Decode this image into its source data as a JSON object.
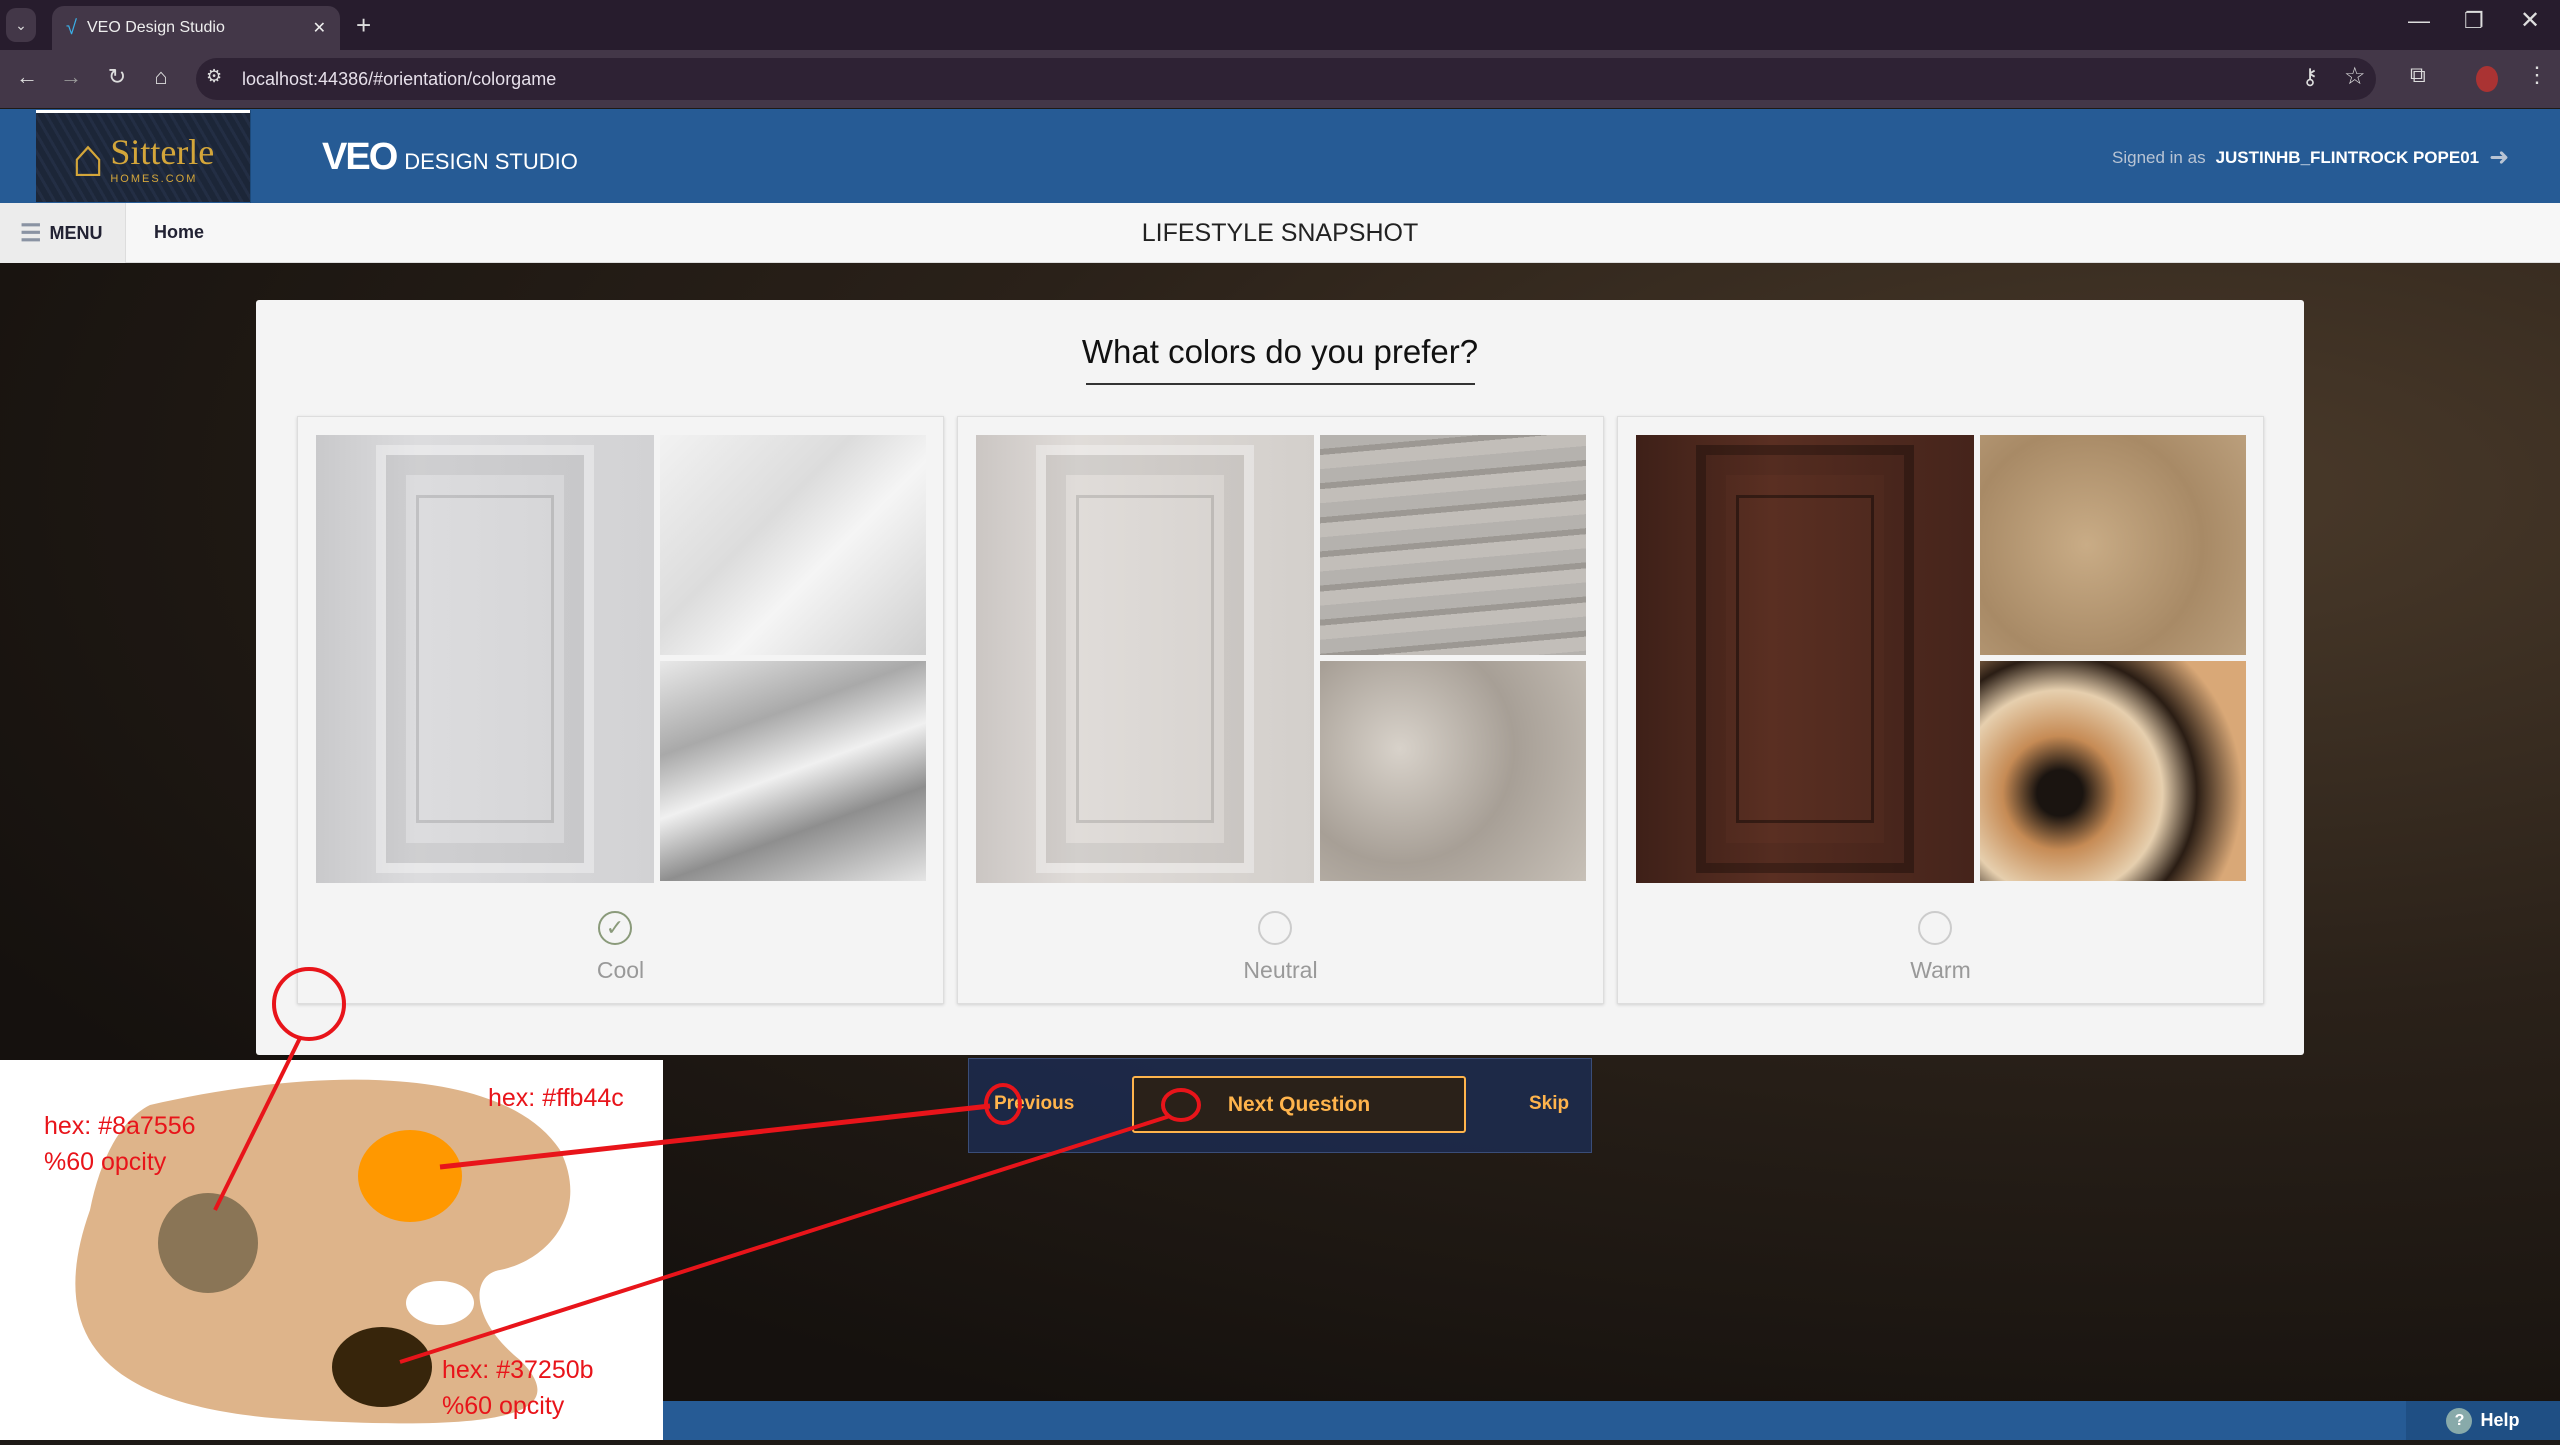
{
  "browser": {
    "tab_title": "VEO Design Studio",
    "url": "localhost:44386/#orientation/colorgame"
  },
  "header": {
    "logo_text": "Sitterle",
    "logo_sub": "HOMES.COM",
    "app_logo": "VEO",
    "app_name": "DESIGN STUDIO",
    "signed_in_label": "Signed in as",
    "username": "JUSTINHB_FLINTROCK POPE01"
  },
  "nav": {
    "menu": "MENU",
    "home": "Home",
    "page_title": "LIFESTYLE SNAPSHOT"
  },
  "question": "What colors do you prefer?",
  "options": [
    {
      "label": "Cool",
      "selected": true
    },
    {
      "label": "Neutral",
      "selected": false
    },
    {
      "label": "Warm",
      "selected": false
    }
  ],
  "buttons": {
    "previous": "Previous",
    "next": "Next Question",
    "skip": "Skip",
    "help": "Help"
  },
  "annotations": {
    "c1": "hex: #8a7556",
    "c1_op": "%60 opcity",
    "c2": "hex: #ffb44c",
    "c3": "hex: #37250b",
    "c3_op": "%60 opcity"
  },
  "colors": {
    "header": "#265b95",
    "accent": "#ffb44c",
    "swatch1": "#8a7556",
    "swatch2": "#ffb44c",
    "swatch3": "#37250b"
  }
}
